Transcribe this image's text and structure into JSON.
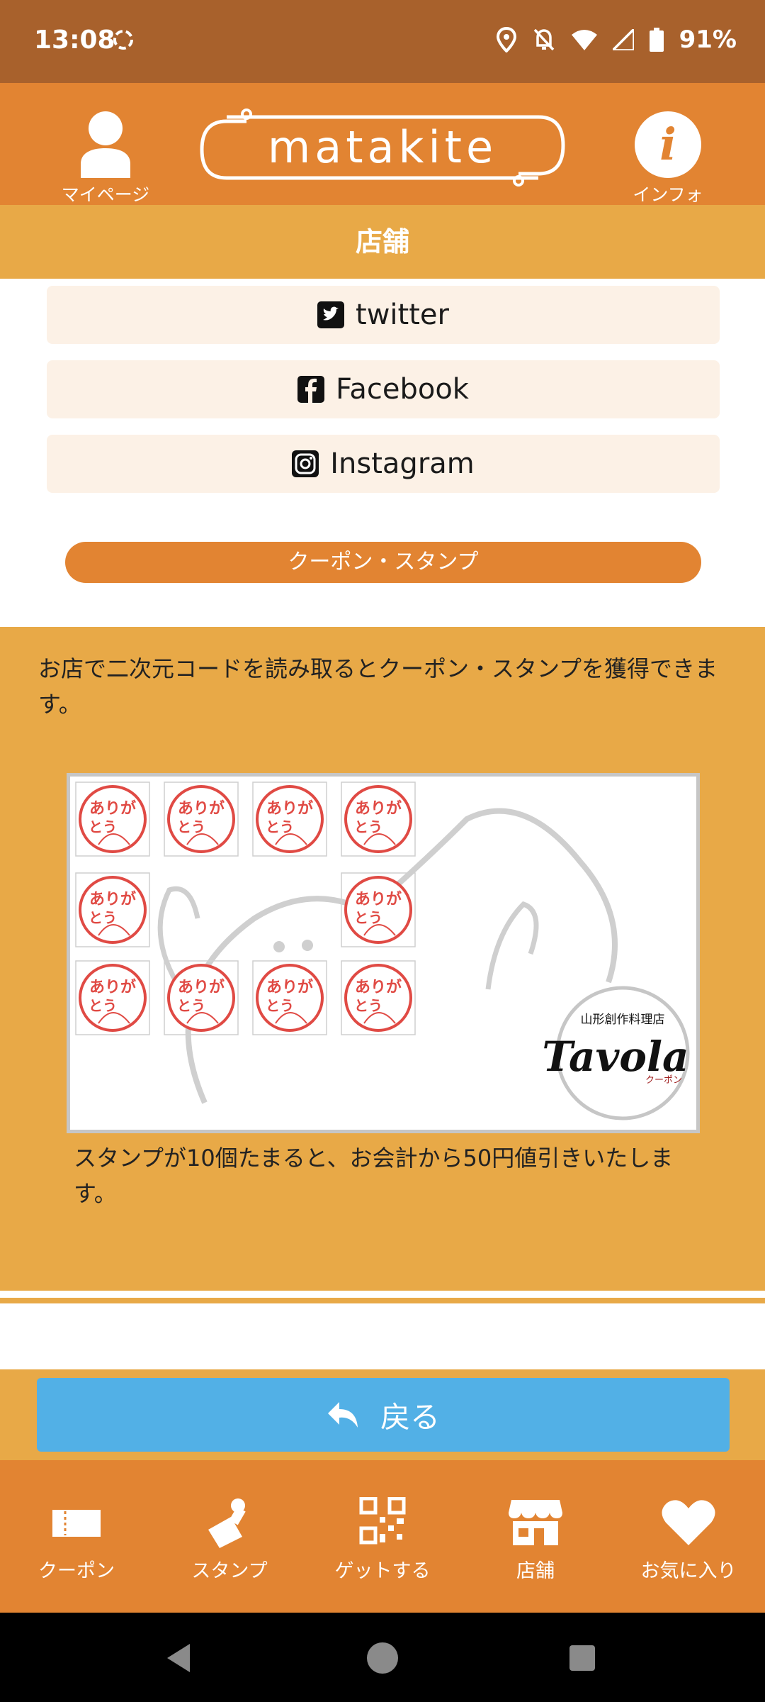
{
  "status_bar": {
    "time": "13:08",
    "battery": "91%"
  },
  "header": {
    "mypage_label": "マイページ",
    "logo_text": "matakite",
    "info_label": "インフォ"
  },
  "section_title": "店舗",
  "social": {
    "twitter": "twitter",
    "facebook": "Facebook",
    "instagram": "Instagram"
  },
  "coupon_stamp_button": "クーポン・スタンプ",
  "stamp_section": {
    "description": "お店で二次元コードを読み取るとクーポン・スタンプを獲得できます。",
    "stamp_text": "ありがとう",
    "shop_tagline": "山形創作料理店",
    "shop_name": "Tavola",
    "shop_sub": "クーポン",
    "note": " スタンプが10個たまると、お会計から50円値引きいたします。"
  },
  "back_button": "戻る",
  "bottom_nav": [
    {
      "label": "クーポン",
      "icon": "ticket-icon"
    },
    {
      "label": "スタンプ",
      "icon": "stamp-icon"
    },
    {
      "label": "ゲットする",
      "icon": "qr-code-icon"
    },
    {
      "label": "店舗",
      "icon": "store-icon"
    },
    {
      "label": "お気に入り",
      "icon": "heart-icon"
    }
  ],
  "colors": {
    "status_bar": "#a8612c",
    "header": "#e28432",
    "section": "#e8a947",
    "social_bg": "#fcf1e6",
    "back_button": "#52b0e6",
    "stamp_red": "#e04a44"
  }
}
